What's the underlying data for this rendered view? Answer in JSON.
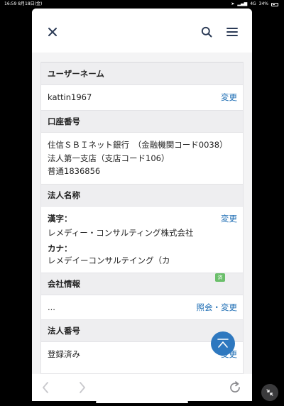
{
  "status_bar": {
    "time": "16:59",
    "date": "8月18日(金)",
    "network": "4G",
    "battery": "34%"
  },
  "header": {
    "close_icon": "close-icon",
    "search_icon": "search-icon",
    "menu_icon": "hamburger-menu-icon"
  },
  "sections": {
    "username": {
      "title": "ユーザーネーム",
      "value": "kattin1967",
      "action": "変更"
    },
    "account": {
      "title": "口座番号",
      "line1": "住信ＳＢＩネット銀行　（金融機関コード0038）",
      "line2": "法人第一支店（支店コード106）",
      "line3": "普通1836856"
    },
    "corp_name": {
      "title": "法人名称",
      "action": "変更",
      "kanji_label": "漢字：",
      "kanji_value": "レメディー・コンサルティング株式会社",
      "kana_label": "カナ：",
      "kana_value": "レメデイーコンサルテイング（カ"
    },
    "company_info": {
      "title": "会社情報",
      "value": "...",
      "action": "照会・変更"
    },
    "corp_number": {
      "title": "法人番号",
      "tag": "済",
      "value": "登録済み",
      "action": "変更"
    }
  },
  "scroll_top_icon": "scroll-to-top-icon",
  "toolbar": {
    "back_icon": "chevron-left-icon",
    "forward_icon": "chevron-right-icon",
    "reload_icon": "reload-icon"
  },
  "colors": {
    "link": "#1d6db4",
    "fab": "#2e78bf",
    "section_header_bg": "#eeeef0",
    "tag": "#6bbf6b"
  }
}
